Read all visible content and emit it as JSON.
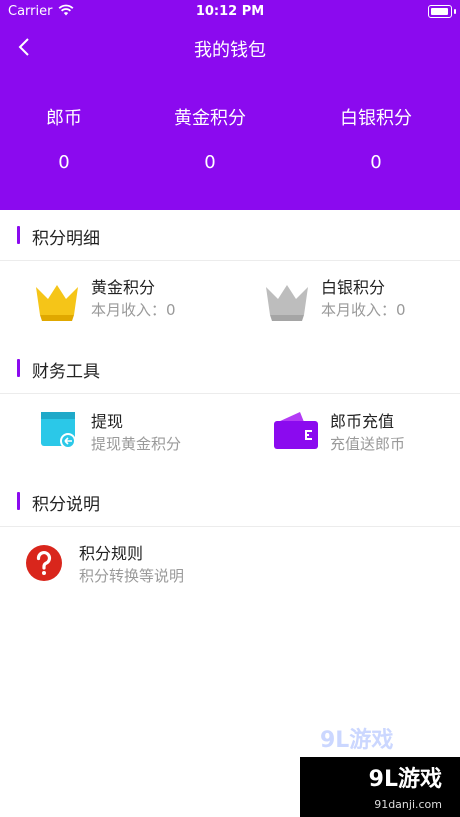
{
  "status_bar": {
    "carrier": "Carrier",
    "time": "10:12 PM"
  },
  "nav": {
    "title": "我的钱包",
    "back_icon": "chevron-left-icon"
  },
  "balances": [
    {
      "label": "郎币",
      "value": "0"
    },
    {
      "label": "黄金积分",
      "value": "0"
    },
    {
      "label": "白银积分",
      "value": "0"
    }
  ],
  "sections": {
    "points_detail": {
      "title": "积分明细",
      "items": [
        {
          "title": "黄金积分",
          "subtitle": "本月收入：0",
          "icon": "gold-crown-icon"
        },
        {
          "title": "白银积分",
          "subtitle": "本月收入：0",
          "icon": "silver-crown-icon"
        }
      ]
    },
    "finance_tools": {
      "title": "财务工具",
      "items": [
        {
          "title": "提现",
          "subtitle": "提现黄金积分",
          "icon": "withdraw-icon"
        },
        {
          "title": "郎币充值",
          "subtitle": "充值送郎币",
          "icon": "wallet-icon"
        }
      ]
    },
    "points_info": {
      "title": "积分说明",
      "items": [
        {
          "title": "积分规则",
          "subtitle": "积分转换等说明",
          "icon": "question-icon"
        }
      ]
    }
  },
  "watermark": {
    "logo": "9L游戏",
    "url": "91danji.com"
  },
  "colors": {
    "primary": "#8B0AEF",
    "gold": "#F5C518",
    "silver": "#BDBDBD",
    "red": "#D9261C"
  }
}
